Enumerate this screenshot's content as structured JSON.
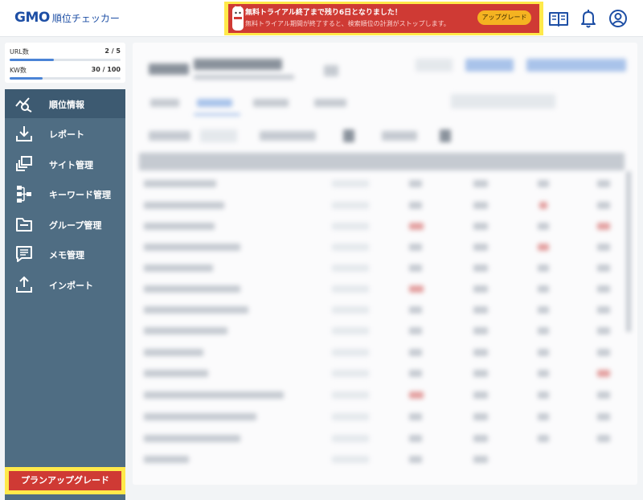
{
  "header": {
    "logo_brand": "GMO",
    "logo_sub": "順位チェッカー",
    "trial_banner": {
      "title": "無料トライアル終了まで残り6日となりました！",
      "subtitle": "無料トライアル期間が終了すると、検索順位の計測がストップします。",
      "button_label": "アップグレード"
    },
    "icons": [
      "manual-book-icon",
      "bell-icon",
      "account-icon"
    ]
  },
  "usage": {
    "url": {
      "label": "URL数",
      "value": "2 / 5",
      "fraction": 0.4
    },
    "kw": {
      "label": "KW数",
      "value": "30 / 100",
      "fraction": 0.3
    }
  },
  "sidebar": {
    "items": [
      {
        "label": "順位情報",
        "icon": "ranking-chart-icon",
        "active": true
      },
      {
        "label": "レポート",
        "icon": "download-icon",
        "active": false
      },
      {
        "label": "サイト管理",
        "icon": "site-windows-icon",
        "active": false
      },
      {
        "label": "キーワード管理",
        "icon": "keyword-tree-icon",
        "active": false
      },
      {
        "label": "グループ管理",
        "icon": "folder-icon",
        "active": false
      },
      {
        "label": "メモ管理",
        "icon": "memo-icon",
        "active": false
      },
      {
        "label": "インポート",
        "icon": "upload-icon",
        "active": false
      }
    ],
    "plan_upgrade_label": "プランアップグレード"
  },
  "colors": {
    "brand_blue": "#1e4fa5",
    "banner_red": "#cf3a34",
    "highlight_yellow": "#ffe94a",
    "upgrade_orange": "#f5b321",
    "sidebar_bg": "#4f6d83",
    "sidebar_active": "#3d5a71"
  }
}
